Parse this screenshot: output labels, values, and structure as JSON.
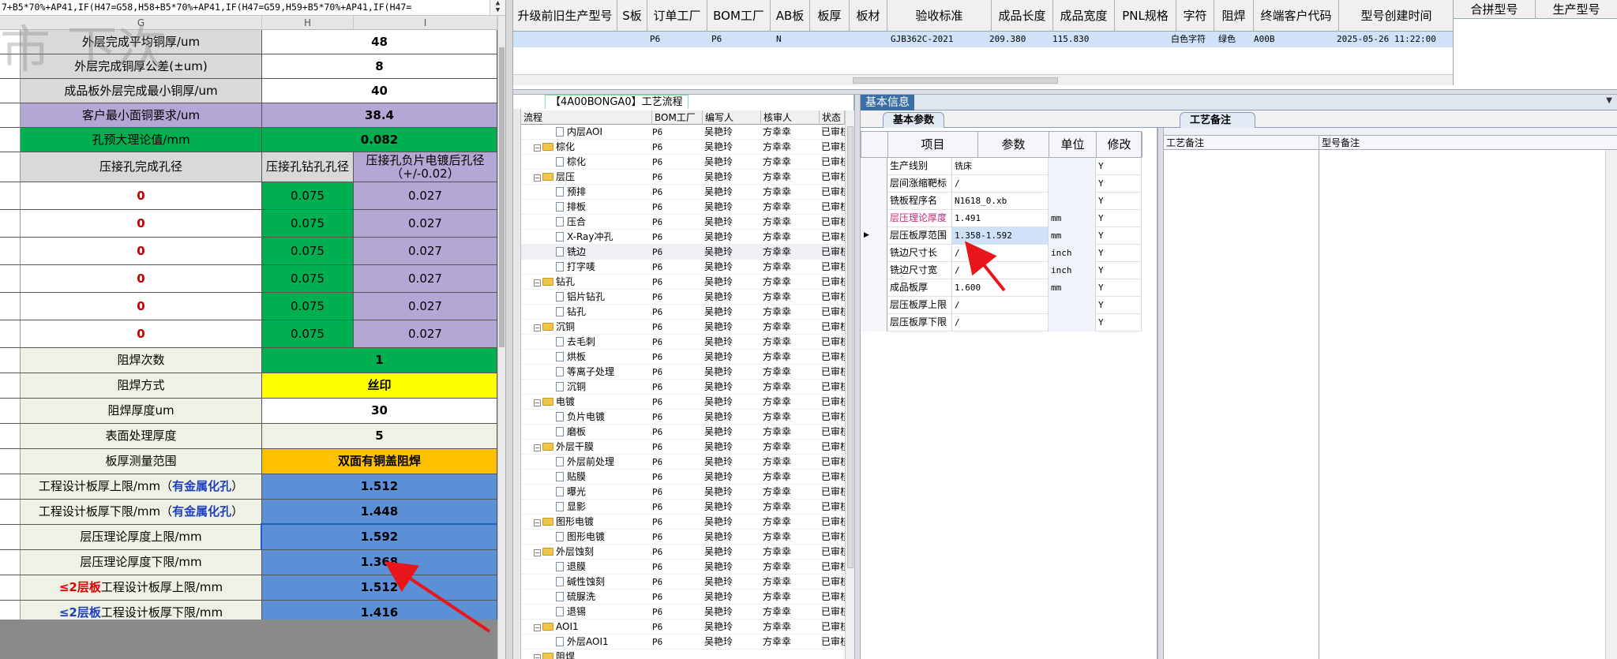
{
  "excel": {
    "formula": "7+B5*70%+AP41,IF(H47=G58,H58+B5*70%+AP41,IF(H47=G59,H59+B5*70%+AP41,IF(H47=",
    "col_headers": [
      "G",
      "H",
      "I"
    ],
    "watermark": "市  下次",
    "rows": [
      {
        "label": "外层完成平均铜厚/um",
        "value": "48",
        "style": "white"
      },
      {
        "label": "外层完成铜厚公差(±um)",
        "value": "8",
        "style": "white"
      },
      {
        "label": "成品板外层完成最小铜厚/um",
        "value": "40",
        "style": "white"
      },
      {
        "label": "客户最小面铜要求/um",
        "value": "38.4",
        "style": "lav"
      },
      {
        "label": "孔预大理论值/mm",
        "value": "0.082",
        "style": "green"
      }
    ],
    "press_header": {
      "c1": "压接孔完成孔径",
      "c2": "压接孔钻孔孔径",
      "c3": "压接孔负片电镀后孔径（+/-0.02）"
    },
    "press_rows": [
      {
        "c1": "0",
        "c2": "0.075",
        "c3": "0.027"
      },
      {
        "c1": "0",
        "c2": "0.075",
        "c3": "0.027"
      },
      {
        "c1": "0",
        "c2": "0.075",
        "c3": "0.027"
      },
      {
        "c1": "0",
        "c2": "0.075",
        "c3": "0.027"
      },
      {
        "c1": "0",
        "c2": "0.075",
        "c3": "0.027"
      },
      {
        "c1": "0",
        "c2": "0.075",
        "c3": "0.027"
      }
    ],
    "mask_rows": [
      {
        "label": "阻焊次数",
        "value": "1",
        "style": "green"
      },
      {
        "label": "阻焊方式",
        "value": "丝印",
        "style": "yellow"
      },
      {
        "label": "阻焊厚度um",
        "value": "30",
        "style": "white"
      },
      {
        "label": "表面处理厚度",
        "value": "5",
        "style": "cream"
      },
      {
        "label": "板厚测量范围",
        "value": "双面有铜盖阻焊",
        "style": "orange"
      }
    ],
    "thick_rows": [
      {
        "pre": "",
        "pre_class": "",
        "label": "工程设计板厚上限/mm（",
        "hl": "有金属化孔",
        "post": "）",
        "value": "1.512"
      },
      {
        "pre": "",
        "pre_class": "",
        "label": "工程设计板厚下限/mm（",
        "hl": "有金属化孔",
        "post": "）",
        "value": "1.448"
      },
      {
        "pre": "",
        "pre_class": "",
        "label": "层压理论厚度上限/mm",
        "hl": "",
        "post": "",
        "value": "1.592"
      },
      {
        "pre": "",
        "pre_class": "",
        "label": "层压理论厚度下限/mm",
        "hl": "",
        "post": "",
        "value": "1.368"
      },
      {
        "pre": "≤2层板",
        "pre_class": "hl-red",
        "label": "工程设计板厚上限/mm",
        "hl": "",
        "post": "",
        "value": "1.512"
      },
      {
        "pre": "≤2层板",
        "pre_class": "hl-blue",
        "label": "工程设计板厚下限/mm",
        "hl": "",
        "post": "",
        "value": "1.416"
      }
    ]
  },
  "top_grid": {
    "headers": [
      "升级前旧生产型号",
      "S板",
      "订单工厂",
      "BOM工厂",
      "AB板",
      "板厚",
      "板材",
      "验收标准",
      "成品长度",
      "成品宽度",
      "PNL规格",
      "字符",
      "阻焊",
      "终端客户代码",
      "型号创建时间"
    ],
    "row": {
      "order_factory": "P6",
      "bom_factory": "P6",
      "ab": "N",
      "standard": "GJB362C-2021",
      "length": "209.380",
      "width": "115.830",
      "char": "白色字符",
      "mask": "绿色",
      "customer": "A00B",
      "created": "2025-05-26 11:22:00"
    },
    "right_headers": [
      "合拼型号",
      "生产型号"
    ]
  },
  "process": {
    "title": "【4A00BONGA0】工艺流程",
    "headers": [
      "流程",
      "BOM工厂",
      "编写人",
      "核审人",
      "状态"
    ],
    "rows": [
      {
        "name": "内层AOI",
        "kind": "doc",
        "bom": "P6",
        "author": "吴艳玲",
        "reviewer": "方幸幸",
        "state": "已审核"
      },
      {
        "name": "棕化",
        "kind": "folder",
        "bom": "P6",
        "author": "吴艳玲",
        "reviewer": "方幸幸",
        "state": "已审核"
      },
      {
        "name": "棕化",
        "kind": "doc",
        "bom": "P6",
        "author": "吴艳玲",
        "reviewer": "方幸幸",
        "state": "已审核"
      },
      {
        "name": "层压",
        "kind": "folder",
        "bom": "P6",
        "author": "吴艳玲",
        "reviewer": "方幸幸",
        "state": "已审核"
      },
      {
        "name": "预排",
        "kind": "doc",
        "bom": "P6",
        "author": "吴艳玲",
        "reviewer": "方幸幸",
        "state": "已审核"
      },
      {
        "name": "排板",
        "kind": "doc",
        "bom": "P6",
        "author": "吴艳玲",
        "reviewer": "方幸幸",
        "state": "已审核"
      },
      {
        "name": "压合",
        "kind": "doc",
        "bom": "P6",
        "author": "吴艳玲",
        "reviewer": "方幸幸",
        "state": "已审核"
      },
      {
        "name": "X-Ray冲孔",
        "kind": "doc",
        "bom": "P6",
        "author": "吴艳玲",
        "reviewer": "方幸幸",
        "state": "已审核"
      },
      {
        "name": "铣边",
        "kind": "doc",
        "bom": "P6",
        "author": "吴艳玲",
        "reviewer": "方幸幸",
        "state": "已审核",
        "selected": true
      },
      {
        "name": "打字唛",
        "kind": "doc",
        "bom": "P6",
        "author": "吴艳玲",
        "reviewer": "方幸幸",
        "state": "已审核"
      },
      {
        "name": "钻孔",
        "kind": "folder",
        "bom": "P6",
        "author": "吴艳玲",
        "reviewer": "方幸幸",
        "state": "已审核"
      },
      {
        "name": "铝片钻孔",
        "kind": "doc",
        "bom": "P6",
        "author": "吴艳玲",
        "reviewer": "方幸幸",
        "state": "已审核"
      },
      {
        "name": "钻孔",
        "kind": "doc",
        "bom": "P6",
        "author": "吴艳玲",
        "reviewer": "方幸幸",
        "state": "已审核"
      },
      {
        "name": "沉铜",
        "kind": "folder",
        "bom": "P6",
        "author": "吴艳玲",
        "reviewer": "方幸幸",
        "state": "已审核"
      },
      {
        "name": "去毛刺",
        "kind": "doc",
        "bom": "P6",
        "author": "吴艳玲",
        "reviewer": "方幸幸",
        "state": "已审核"
      },
      {
        "name": "烘板",
        "kind": "doc",
        "bom": "P6",
        "author": "吴艳玲",
        "reviewer": "方幸幸",
        "state": "已审核"
      },
      {
        "name": "等离子处理",
        "kind": "doc",
        "bom": "P6",
        "author": "吴艳玲",
        "reviewer": "方幸幸",
        "state": "已审核"
      },
      {
        "name": "沉铜",
        "kind": "doc",
        "bom": "P6",
        "author": "吴艳玲",
        "reviewer": "方幸幸",
        "state": "已审核"
      },
      {
        "name": "电镀",
        "kind": "folder",
        "bom": "P6",
        "author": "吴艳玲",
        "reviewer": "方幸幸",
        "state": "已审核"
      },
      {
        "name": "负片电镀",
        "kind": "doc",
        "bom": "P6",
        "author": "吴艳玲",
        "reviewer": "方幸幸",
        "state": "已审核"
      },
      {
        "name": "磨板",
        "kind": "doc",
        "bom": "P6",
        "author": "吴艳玲",
        "reviewer": "方幸幸",
        "state": "已审核"
      },
      {
        "name": "外层干膜",
        "kind": "folder",
        "bom": "P6",
        "author": "吴艳玲",
        "reviewer": "方幸幸",
        "state": "已审核"
      },
      {
        "name": "外层前处理",
        "kind": "doc",
        "bom": "P6",
        "author": "吴艳玲",
        "reviewer": "方幸幸",
        "state": "已审核"
      },
      {
        "name": "贴膜",
        "kind": "doc",
        "bom": "P6",
        "author": "吴艳玲",
        "reviewer": "方幸幸",
        "state": "已审核"
      },
      {
        "name": "曝光",
        "kind": "doc",
        "bom": "P6",
        "author": "吴艳玲",
        "reviewer": "方幸幸",
        "state": "已审核"
      },
      {
        "name": "显影",
        "kind": "doc",
        "bom": "P6",
        "author": "吴艳玲",
        "reviewer": "方幸幸",
        "state": "已审核"
      },
      {
        "name": "图形电镀",
        "kind": "folder",
        "bom": "P6",
        "author": "吴艳玲",
        "reviewer": "方幸幸",
        "state": "已审核"
      },
      {
        "name": "图形电镀",
        "kind": "doc",
        "bom": "P6",
        "author": "吴艳玲",
        "reviewer": "方幸幸",
        "state": "已审核"
      },
      {
        "name": "外层蚀刻",
        "kind": "folder",
        "bom": "P6",
        "author": "吴艳玲",
        "reviewer": "方幸幸",
        "state": "已审核"
      },
      {
        "name": "退膜",
        "kind": "doc",
        "bom": "P6",
        "author": "吴艳玲",
        "reviewer": "方幸幸",
        "state": "已审核"
      },
      {
        "name": "碱性蚀刻",
        "kind": "doc",
        "bom": "P6",
        "author": "吴艳玲",
        "reviewer": "方幸幸",
        "state": "已审核"
      },
      {
        "name": "硫脲洗",
        "kind": "doc",
        "bom": "P6",
        "author": "吴艳玲",
        "reviewer": "方幸幸",
        "state": "已审核"
      },
      {
        "name": "退锡",
        "kind": "doc",
        "bom": "P6",
        "author": "吴艳玲",
        "reviewer": "方幸幸",
        "state": "已审核"
      },
      {
        "name": "AOI1",
        "kind": "folder",
        "bom": "P6",
        "author": "吴艳玲",
        "reviewer": "方幸幸",
        "state": "已审核"
      },
      {
        "name": "外层AOI1",
        "kind": "doc",
        "bom": "P6",
        "author": "吴艳玲",
        "reviewer": "方幸幸",
        "state": "已审核"
      },
      {
        "name": "阻焊",
        "kind": "folder",
        "bom": "",
        "author": "",
        "reviewer": "",
        "state": ""
      }
    ]
  },
  "info": {
    "panel_tab": "基本信息",
    "sub_tab_params": "基本参数",
    "sub_tab_notes": "工艺备注",
    "headers": [
      "项目",
      "参数",
      "单位",
      "修改"
    ],
    "rows": [
      {
        "name": "生产线别",
        "value": "铣床",
        "unit": "",
        "mod": "Y"
      },
      {
        "name": "层间涨缩靶标",
        "value": "/",
        "unit": "",
        "mod": "Y"
      },
      {
        "name": "铣板程序名",
        "value": "N1618_0.xb",
        "unit": "",
        "mod": "Y"
      },
      {
        "name": "层压理论厚度",
        "value": "1.491",
        "unit": "mm",
        "mod": "Y",
        "pink": true
      },
      {
        "name": "层压板厚范围",
        "value": "1.358-1.592",
        "unit": "mm",
        "mod": "Y",
        "current": true
      },
      {
        "name": "铣边尺寸长",
        "value": "/",
        "unit": "inch",
        "mod": "Y"
      },
      {
        "name": "铣边尺寸宽",
        "value": "/",
        "unit": "inch",
        "mod": "Y"
      },
      {
        "name": "成品板厚",
        "value": "1.600",
        "unit": "mm",
        "mod": "Y"
      },
      {
        "name": "层压板厚上限",
        "value": "/",
        "unit": "",
        "mod": "Y"
      },
      {
        "name": "层压板厚下限",
        "value": "/",
        "unit": "",
        "mod": "Y"
      }
    ],
    "notes_headers": [
      "工艺备注",
      "型号备注"
    ]
  }
}
